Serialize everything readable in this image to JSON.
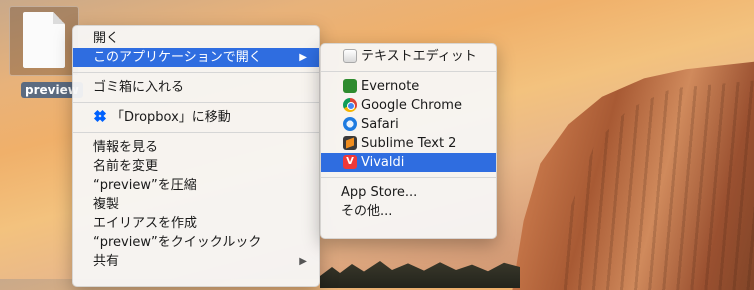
{
  "desktop": {
    "file_label": "preview"
  },
  "main_menu": {
    "open": "開く",
    "open_with": "このアプリケーションで開く",
    "trash": "ゴミ箱に入れる",
    "dropbox_move": "「Dropbox」に移動",
    "get_info": "情報を見る",
    "rename": "名前を変更",
    "compress": "“preview”を圧縮",
    "duplicate": "複製",
    "make_alias": "エイリアスを作成",
    "quick_look": "“preview”をクイックルック",
    "share": "共有"
  },
  "submenu": {
    "default_app": "テキストエディット",
    "apps": [
      "Evernote",
      "Google Chrome",
      "Safari",
      "Sublime Text 2",
      "Vivaldi"
    ],
    "app_store": "App Store...",
    "other": "その他..."
  },
  "colors": {
    "selection": "#2f6de0",
    "menu_bg": "#f6f6f6"
  },
  "icons": {
    "textedit": "textedit-icon",
    "evernote": "evernote-icon",
    "chrome": "chrome-icon",
    "safari": "safari-icon",
    "sublime": "sublime-text-icon",
    "vivaldi": "vivaldi-icon",
    "dropbox": "dropbox-icon"
  }
}
